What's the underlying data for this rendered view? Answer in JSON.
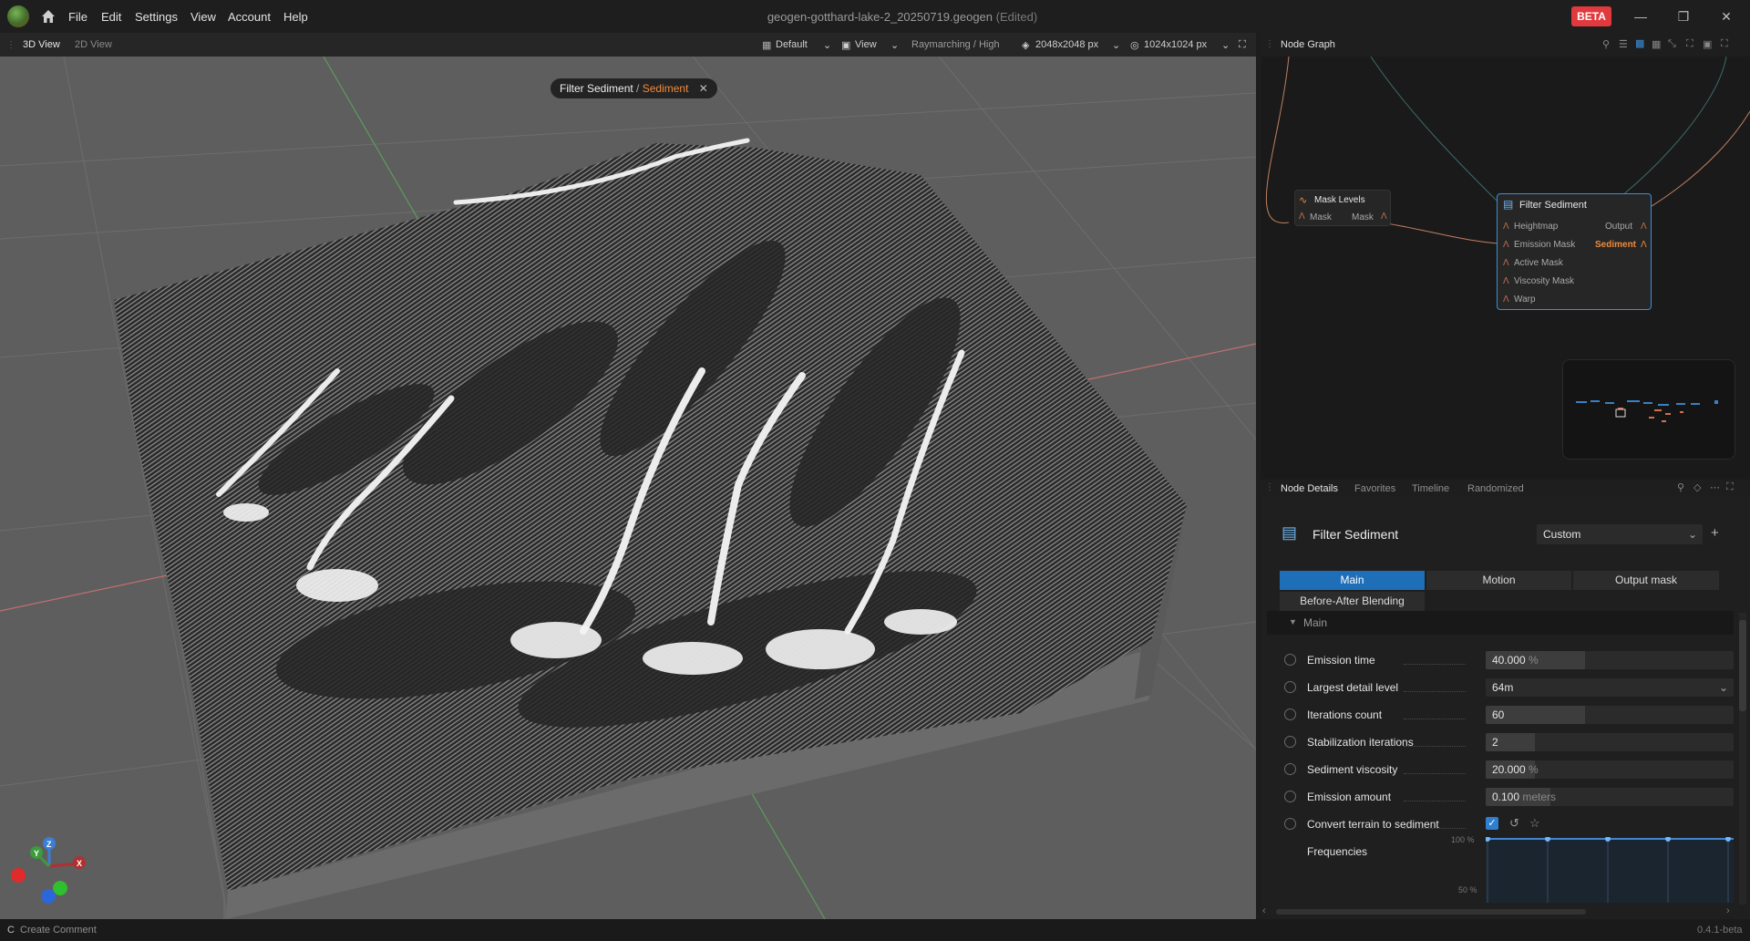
{
  "menu": {
    "items": [
      "File",
      "Edit",
      "Settings",
      "View",
      "Account",
      "Help"
    ]
  },
  "window": {
    "title": "geogen-gotthard-lake-2_20250719.geogen",
    "edited": "(Edited)",
    "beta_badge": "BETA"
  },
  "viewport_toolbar": {
    "tabs": [
      "3D View",
      "2D View"
    ],
    "preset": "Default",
    "view": "View",
    "render_mode": "Raymarching / High",
    "resolution": "2048x2048 px",
    "tile_resolution": "1024x1024 px"
  },
  "breadcrumb": {
    "node": "Filter Sediment",
    "separator": " / ",
    "output": "Sediment"
  },
  "gizmo": {
    "x": "X",
    "y": "Y",
    "z": "Z"
  },
  "node_graph": {
    "title": "Node Graph",
    "mask_levels": {
      "title": "Mask Levels",
      "input": "Mask",
      "output": "Mask"
    },
    "filter_sediment": {
      "title": "Filter Sediment",
      "inputs": [
        "Heightmap",
        "Emission Mask",
        "Active Mask",
        "Viscosity Mask",
        "Warp"
      ],
      "outputs": [
        "Output",
        "Sediment"
      ]
    }
  },
  "node_details": {
    "tabs": [
      "Node Details",
      "Favorites",
      "Timeline",
      "Randomized"
    ],
    "node_title": "Filter Sediment",
    "preset_select": "Custom",
    "param_tabs": [
      "Main",
      "Motion",
      "Output mask",
      "Before-After Blending"
    ],
    "section": "Main",
    "params": [
      {
        "label": "Emission time",
        "value": "40.000",
        "unit": "%",
        "fill": 0.4
      },
      {
        "label": "Largest detail level",
        "value": "64m",
        "unit": "",
        "fill": 0
      },
      {
        "label": "Iterations count",
        "value": "60",
        "unit": "",
        "fill": 0.4
      },
      {
        "label": "Stabilization iterations",
        "value": "2",
        "unit": "",
        "fill": 0.2
      },
      {
        "label": "Sediment viscosity",
        "value": "20.000",
        "unit": "%",
        "fill": 0.2
      },
      {
        "label": "Emission amount",
        "value": "0.100",
        "unit": "meters",
        "fill": 0.26
      },
      {
        "label": "Convert terrain to sediment",
        "checked": true
      },
      {
        "label": "Frequencies"
      }
    ],
    "frequency_axis": [
      "100 %",
      "50 %"
    ],
    "frequency_values": [
      1,
      1,
      1,
      1,
      1
    ]
  },
  "status": {
    "shortcut": "C",
    "create_comment": "Create Comment",
    "version": "0.4.1-beta"
  },
  "colors": {
    "accent": "#1f6fb8",
    "beta": "#e0393e",
    "sediment_port": "#f08a3c",
    "selection": "#3b8ed8"
  }
}
